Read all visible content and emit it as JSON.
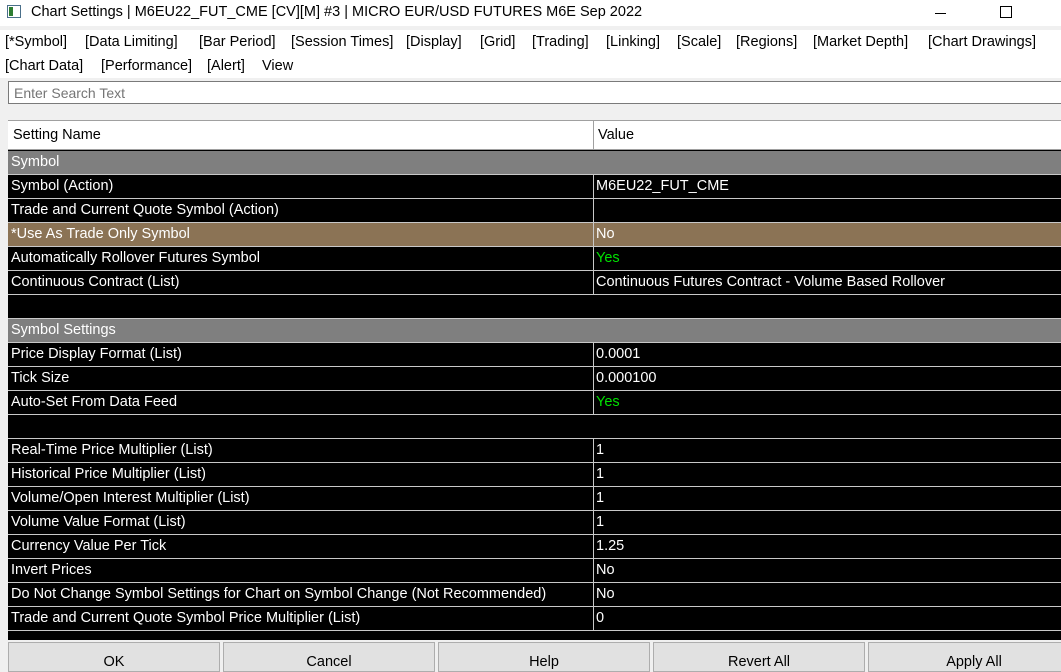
{
  "window": {
    "title": "Chart Settings | M6EU22_FUT_CME [CV][M]  #3 | MICRO EUR/USD FUTURES M6E Sep 2022"
  },
  "menu": [
    "[*Symbol]",
    "[Data Limiting]",
    "[Bar Period]",
    "[Session Times]",
    "[Display]",
    "[Grid]",
    "[Trading]",
    "[Linking]",
    "[Scale]",
    "[Regions]",
    "[Market Depth]",
    "[Chart Drawings]",
    "[Chart Data]",
    "[Performance]",
    "[Alert]",
    "View"
  ],
  "search": {
    "placeholder": "Enter Search Text"
  },
  "grid": {
    "header": {
      "name": "Setting Name",
      "value": "Value"
    },
    "rows": [
      {
        "type": "section",
        "name": "Symbol"
      },
      {
        "type": "row",
        "name": "Symbol (Action)",
        "value": "M6EU22_FUT_CME"
      },
      {
        "type": "row",
        "name": "Trade and Current Quote Symbol (Action)",
        "value": ""
      },
      {
        "type": "highlight",
        "name": "*Use As Trade Only Symbol",
        "value": "No"
      },
      {
        "type": "row",
        "name": "Automatically Rollover Futures Symbol",
        "value": "Yes",
        "value_color": "#00e000"
      },
      {
        "type": "row",
        "name": "Continuous Contract (List)",
        "value": "Continuous Futures Contract - Volume Based Rollover"
      },
      {
        "type": "blank"
      },
      {
        "type": "section",
        "name": "Symbol Settings"
      },
      {
        "type": "row",
        "name": "Price Display Format (List)",
        "value": "0.0001"
      },
      {
        "type": "row",
        "name": "Tick Size",
        "value": "0.000100"
      },
      {
        "type": "row",
        "name": "Auto-Set From Data Feed",
        "value": "Yes",
        "value_color": "#00e000"
      },
      {
        "type": "blank"
      },
      {
        "type": "row",
        "name": "Real-Time Price Multiplier (List)",
        "value": "1"
      },
      {
        "type": "row",
        "name": "Historical Price Multiplier (List)",
        "value": "1"
      },
      {
        "type": "row",
        "name": "Volume/Open Interest Multiplier (List)",
        "value": "1"
      },
      {
        "type": "row",
        "name": "Volume Value Format (List)",
        "value": "1"
      },
      {
        "type": "row",
        "name": "Currency Value Per Tick",
        "value": "1.25"
      },
      {
        "type": "row",
        "name": "Invert Prices",
        "value": "No"
      },
      {
        "type": "row",
        "name": "Do Not Change Symbol Settings for Chart on Symbol Change (Not Recommended)",
        "value": "No"
      },
      {
        "type": "row",
        "name": "Trade and Current Quote Symbol Price Multiplier (List)",
        "value": "0"
      }
    ]
  },
  "buttons": {
    "ok": "OK",
    "cancel": "Cancel",
    "help": "Help",
    "revert": "Revert All",
    "apply": "Apply All"
  },
  "colors": {
    "section": "#7f7f7f",
    "highlight": "#8b7355",
    "grid_bg": "#000000",
    "yes": "#00e000"
  }
}
